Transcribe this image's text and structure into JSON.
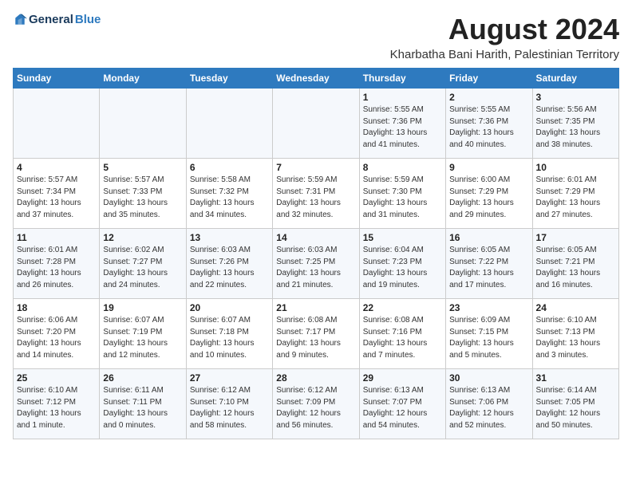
{
  "logo": {
    "general": "General",
    "blue": "Blue"
  },
  "header": {
    "month": "August 2024",
    "location": "Kharbatha Bani Harith, Palestinian Territory"
  },
  "weekdays": [
    "Sunday",
    "Monday",
    "Tuesday",
    "Wednesday",
    "Thursday",
    "Friday",
    "Saturday"
  ],
  "weeks": [
    [
      {
        "day": "",
        "info": ""
      },
      {
        "day": "",
        "info": ""
      },
      {
        "day": "",
        "info": ""
      },
      {
        "day": "",
        "info": ""
      },
      {
        "day": "1",
        "info": "Sunrise: 5:55 AM\nSunset: 7:36 PM\nDaylight: 13 hours\nand 41 minutes."
      },
      {
        "day": "2",
        "info": "Sunrise: 5:55 AM\nSunset: 7:36 PM\nDaylight: 13 hours\nand 40 minutes."
      },
      {
        "day": "3",
        "info": "Sunrise: 5:56 AM\nSunset: 7:35 PM\nDaylight: 13 hours\nand 38 minutes."
      }
    ],
    [
      {
        "day": "4",
        "info": "Sunrise: 5:57 AM\nSunset: 7:34 PM\nDaylight: 13 hours\nand 37 minutes."
      },
      {
        "day": "5",
        "info": "Sunrise: 5:57 AM\nSunset: 7:33 PM\nDaylight: 13 hours\nand 35 minutes."
      },
      {
        "day": "6",
        "info": "Sunrise: 5:58 AM\nSunset: 7:32 PM\nDaylight: 13 hours\nand 34 minutes."
      },
      {
        "day": "7",
        "info": "Sunrise: 5:59 AM\nSunset: 7:31 PM\nDaylight: 13 hours\nand 32 minutes."
      },
      {
        "day": "8",
        "info": "Sunrise: 5:59 AM\nSunset: 7:30 PM\nDaylight: 13 hours\nand 31 minutes."
      },
      {
        "day": "9",
        "info": "Sunrise: 6:00 AM\nSunset: 7:29 PM\nDaylight: 13 hours\nand 29 minutes."
      },
      {
        "day": "10",
        "info": "Sunrise: 6:01 AM\nSunset: 7:29 PM\nDaylight: 13 hours\nand 27 minutes."
      }
    ],
    [
      {
        "day": "11",
        "info": "Sunrise: 6:01 AM\nSunset: 7:28 PM\nDaylight: 13 hours\nand 26 minutes."
      },
      {
        "day": "12",
        "info": "Sunrise: 6:02 AM\nSunset: 7:27 PM\nDaylight: 13 hours\nand 24 minutes."
      },
      {
        "day": "13",
        "info": "Sunrise: 6:03 AM\nSunset: 7:26 PM\nDaylight: 13 hours\nand 22 minutes."
      },
      {
        "day": "14",
        "info": "Sunrise: 6:03 AM\nSunset: 7:25 PM\nDaylight: 13 hours\nand 21 minutes."
      },
      {
        "day": "15",
        "info": "Sunrise: 6:04 AM\nSunset: 7:23 PM\nDaylight: 13 hours\nand 19 minutes."
      },
      {
        "day": "16",
        "info": "Sunrise: 6:05 AM\nSunset: 7:22 PM\nDaylight: 13 hours\nand 17 minutes."
      },
      {
        "day": "17",
        "info": "Sunrise: 6:05 AM\nSunset: 7:21 PM\nDaylight: 13 hours\nand 16 minutes."
      }
    ],
    [
      {
        "day": "18",
        "info": "Sunrise: 6:06 AM\nSunset: 7:20 PM\nDaylight: 13 hours\nand 14 minutes."
      },
      {
        "day": "19",
        "info": "Sunrise: 6:07 AM\nSunset: 7:19 PM\nDaylight: 13 hours\nand 12 minutes."
      },
      {
        "day": "20",
        "info": "Sunrise: 6:07 AM\nSunset: 7:18 PM\nDaylight: 13 hours\nand 10 minutes."
      },
      {
        "day": "21",
        "info": "Sunrise: 6:08 AM\nSunset: 7:17 PM\nDaylight: 13 hours\nand 9 minutes."
      },
      {
        "day": "22",
        "info": "Sunrise: 6:08 AM\nSunset: 7:16 PM\nDaylight: 13 hours\nand 7 minutes."
      },
      {
        "day": "23",
        "info": "Sunrise: 6:09 AM\nSunset: 7:15 PM\nDaylight: 13 hours\nand 5 minutes."
      },
      {
        "day": "24",
        "info": "Sunrise: 6:10 AM\nSunset: 7:13 PM\nDaylight: 13 hours\nand 3 minutes."
      }
    ],
    [
      {
        "day": "25",
        "info": "Sunrise: 6:10 AM\nSunset: 7:12 PM\nDaylight: 13 hours\nand 1 minute."
      },
      {
        "day": "26",
        "info": "Sunrise: 6:11 AM\nSunset: 7:11 PM\nDaylight: 13 hours\nand 0 minutes."
      },
      {
        "day": "27",
        "info": "Sunrise: 6:12 AM\nSunset: 7:10 PM\nDaylight: 12 hours\nand 58 minutes."
      },
      {
        "day": "28",
        "info": "Sunrise: 6:12 AM\nSunset: 7:09 PM\nDaylight: 12 hours\nand 56 minutes."
      },
      {
        "day": "29",
        "info": "Sunrise: 6:13 AM\nSunset: 7:07 PM\nDaylight: 12 hours\nand 54 minutes."
      },
      {
        "day": "30",
        "info": "Sunrise: 6:13 AM\nSunset: 7:06 PM\nDaylight: 12 hours\nand 52 minutes."
      },
      {
        "day": "31",
        "info": "Sunrise: 6:14 AM\nSunset: 7:05 PM\nDaylight: 12 hours\nand 50 minutes."
      }
    ]
  ]
}
